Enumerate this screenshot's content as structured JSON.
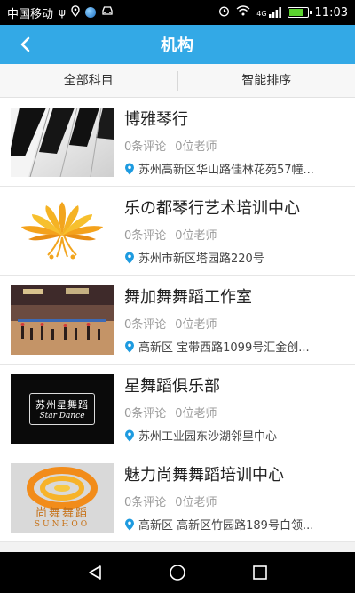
{
  "status_bar": {
    "carrier": "中国移动",
    "network": "4G",
    "time": "11:03"
  },
  "app_bar": {
    "title": "机构",
    "back_icon": "back-arrow-icon"
  },
  "filters": {
    "subject": "全部科目",
    "sort": "智能排序"
  },
  "institutions": [
    {
      "name": "博雅琴行",
      "reviews": "0条评论",
      "teachers": "0位老师",
      "address": "苏州高新区华山路佳林花苑57幢..."
    },
    {
      "name": "乐の都琴行艺术培训中心",
      "reviews": "0条评论",
      "teachers": "0位老师",
      "address": "苏州市新区塔园路220号"
    },
    {
      "name": "舞加舞舞蹈工作室",
      "reviews": "0条评论",
      "teachers": "0位老师",
      "address": "高新区 宝带西路1099号汇金创..."
    },
    {
      "name": "星舞蹈俱乐部",
      "reviews": "0条评论",
      "teachers": "0位老师",
      "address": "苏州工业园东沙湖邻里中心",
      "logo_text": "苏州星舞蹈",
      "logo_subtext": "Star Dance"
    },
    {
      "name": "魅力尚舞舞蹈培训中心",
      "reviews": "0条评论",
      "teachers": "0位老师",
      "address": "高新区 高新区竹园路189号白领...",
      "logo_text": "尚舞舞蹈",
      "logo_subtext": "SUNHOO"
    }
  ],
  "colors": {
    "app_bar": "#33a9e6",
    "location_pin": "#1e9be0"
  }
}
